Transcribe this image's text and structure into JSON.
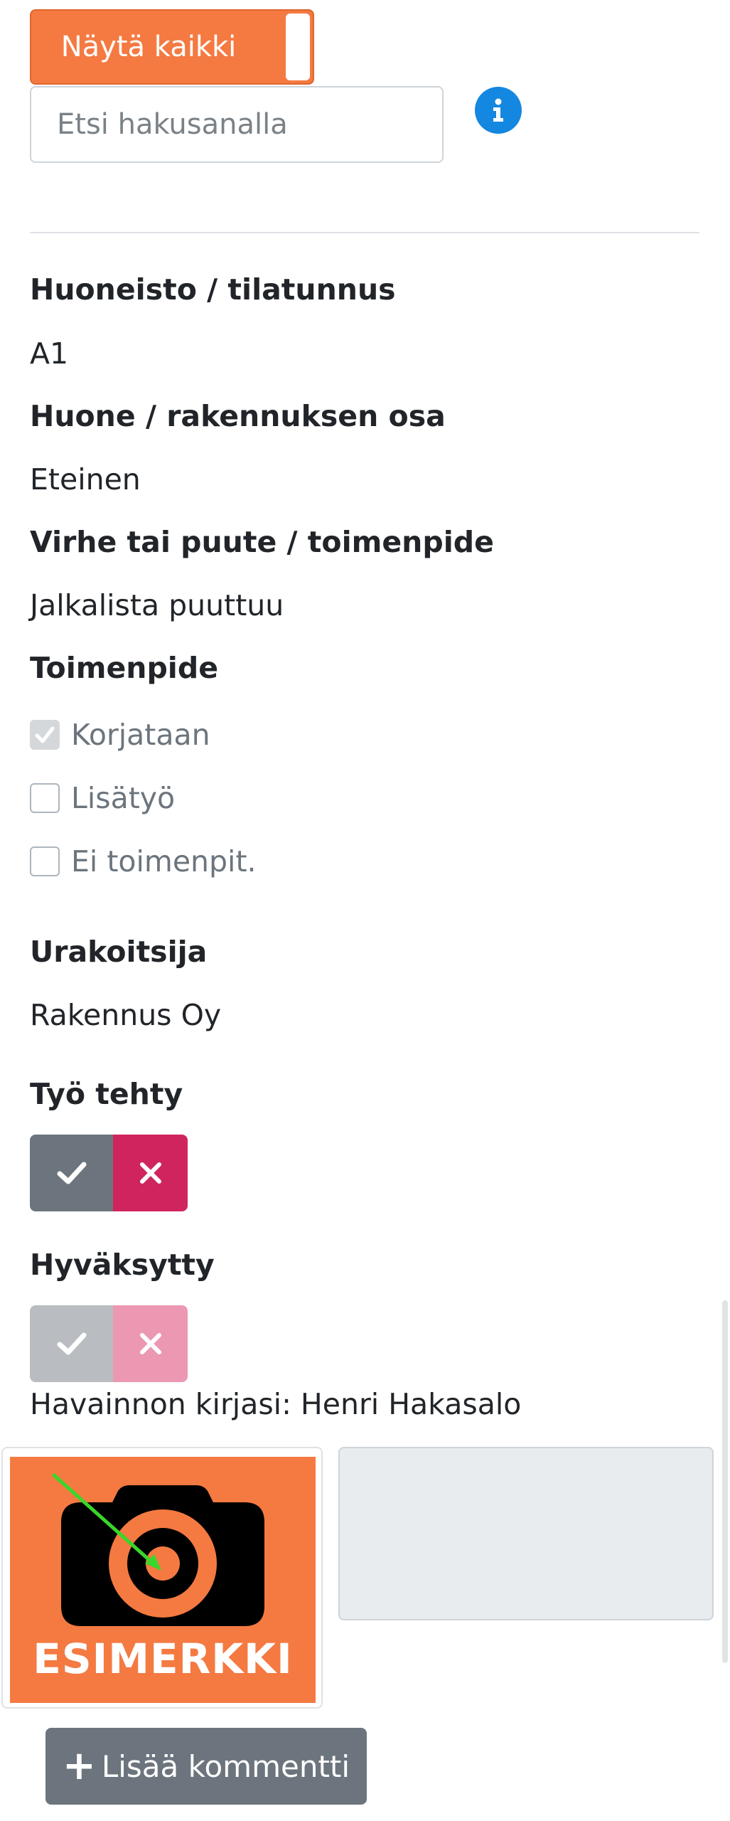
{
  "toggle": {
    "label": "Näytä kaikki"
  },
  "search": {
    "placeholder": "Etsi hakusanalla"
  },
  "fields": {
    "apartment_label": "Huoneisto / tilatunnus",
    "apartment_value": "A1",
    "room_label": "Huone / rakennuksen osa",
    "room_value": "Eteinen",
    "defect_label": "Virhe tai puute / toimenpide",
    "defect_value": "Jalkalista puuttuu",
    "action_label": "Toimenpide",
    "contractor_label": "Urakoitsija",
    "contractor_value": "Rakennus Oy",
    "work_done_label": "Työ tehty",
    "accepted_label": "Hyväksytty",
    "author_text": "Havainnon kirjasi: Henri Hakasalo"
  },
  "actions": [
    {
      "label": "Korjataan",
      "checked": true
    },
    {
      "label": "Lisätyö",
      "checked": false
    },
    {
      "label": "Ei toimenpit.",
      "checked": false
    }
  ],
  "photo": {
    "caption": "ESIMERKKI"
  },
  "add_comment": {
    "label": "Lisää kommentti"
  },
  "colors": {
    "orange": "#f47a42",
    "info_blue": "#1487e0",
    "gray_button": "#6c757d",
    "reject_red": "#d0245e",
    "arrow_green": "#3ad62a"
  }
}
